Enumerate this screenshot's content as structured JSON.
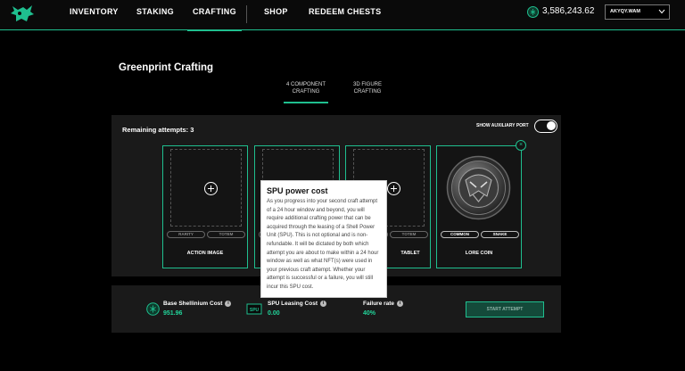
{
  "nav": {
    "items": [
      {
        "label": "INVENTORY"
      },
      {
        "label": "STAKING"
      },
      {
        "label": "CRAFTING"
      },
      {
        "label": "SHOP"
      },
      {
        "label": "REDEEM CHESTS"
      }
    ],
    "balance": "3,586,243.62",
    "account": "AKYQY.WAM"
  },
  "page": {
    "title": "Greenprint Crafting",
    "tabs": [
      {
        "line1": "4 COMPONENT",
        "line2": "CRAFTING"
      },
      {
        "line1": "3D FIGURE",
        "line2": "CRAFTING"
      }
    ]
  },
  "panel": {
    "remaining": "Remaining attempts: 3",
    "aux_label": "SHOW AUXILIARY PORT",
    "cards": [
      {
        "label": "ACTION IMAGE",
        "pills": [
          "RARITY",
          "TOTEM"
        ]
      },
      {
        "label": "",
        "pills": [
          "",
          ""
        ]
      },
      {
        "label": "TABLET",
        "pills": [
          "",
          "TOTEM"
        ]
      },
      {
        "label": "LORE COIN",
        "pills": [
          "COMMON",
          "SNAKE"
        ],
        "close": "×"
      }
    ]
  },
  "costs": {
    "base_label": "Base Shellinium Cost",
    "base_value": "951.96",
    "spu_badge": "SPU",
    "spu_label": "SPU Leasing Cost",
    "spu_value": "0.00",
    "failure_label": "Failure rate",
    "failure_value": "40%",
    "info": "i",
    "start": "START ATTEMPT"
  },
  "tooltip": {
    "title": "SPU power cost",
    "body": "As you progress into your second craft attempt of a 24 hour window and beyond, you will require additional crafting power that can be acquired through the leasing of a Shell Power Unit (SPU). This is not optional and is non-refundable. It will be dictated by both which attempt you are about to make within a 24 hour window as well as what NFT(s) were used in your previous craft attempt. Whether your attempt is successful or a failure, you will still incur this SPU cost."
  },
  "colors": {
    "accent": "#1fbf8f",
    "value_green": "#22d49a"
  }
}
